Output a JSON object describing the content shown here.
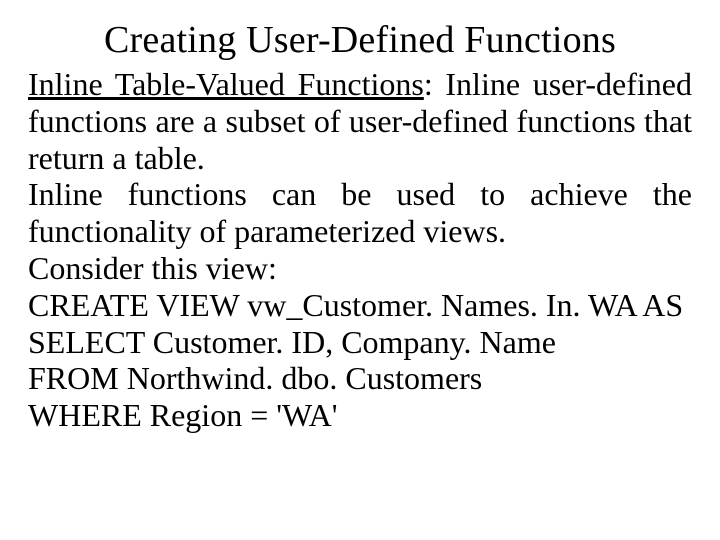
{
  "slide": {
    "title": "Creating User-Defined Functions",
    "heading_underlined": "Inline Table-Valued Functions",
    "para1_rest": ": Inline user-defined functions are a subset of user-defined functions that return a table.",
    "para2": "Inline functions can be used to achieve the functionality of parameterized views.",
    "para3": "Consider this view:",
    "code1": "CREATE VIEW vw_Customer. Names. In. WA AS",
    "code2": "SELECT Customer. ID, Company. Name",
    "code3": "FROM Northwind. dbo. Customers",
    "code4": "WHERE Region = 'WA'"
  }
}
